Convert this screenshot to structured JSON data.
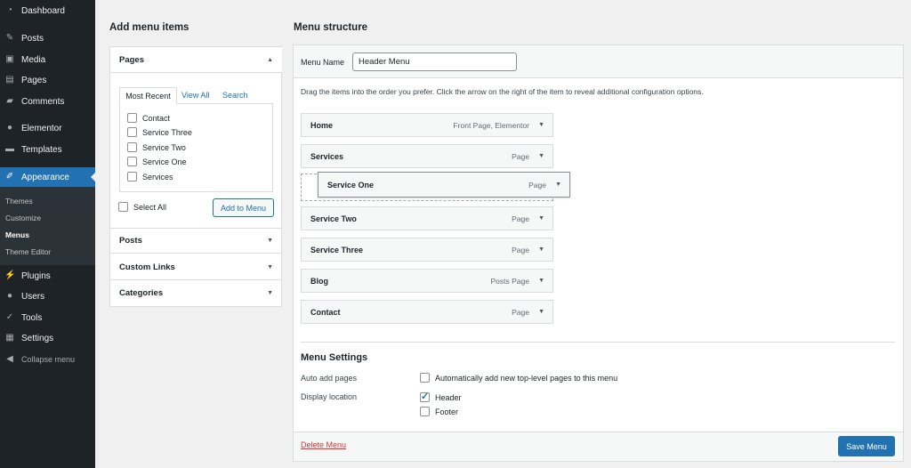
{
  "sidebar": {
    "items": [
      {
        "label": "Dashboard",
        "icon": "dashboard-icon"
      },
      {
        "label": "Posts",
        "icon": "pin-icon"
      },
      {
        "label": "Media",
        "icon": "media-icon"
      },
      {
        "label": "Pages",
        "icon": "pages-icon"
      },
      {
        "label": "Comments",
        "icon": "comment-icon"
      },
      {
        "label": "Elementor",
        "icon": "elementor-icon"
      },
      {
        "label": "Templates",
        "icon": "folder-icon"
      },
      {
        "label": "Appearance",
        "icon": "brush-icon"
      },
      {
        "label": "Plugins",
        "icon": "plugin-icon"
      },
      {
        "label": "Users",
        "icon": "user-icon"
      },
      {
        "label": "Tools",
        "icon": "wrench-icon"
      },
      {
        "label": "Settings",
        "icon": "settings-icon"
      },
      {
        "label": "Collapse menu",
        "icon": "collapse-icon"
      }
    ],
    "submenu": [
      "Themes",
      "Customize",
      "Menus",
      "Theme Editor"
    ]
  },
  "add_items": {
    "title": "Add menu items",
    "pages": {
      "title": "Pages",
      "tabs": [
        "Most Recent",
        "View All",
        "Search"
      ],
      "list": [
        "Contact",
        "Service Three",
        "Service Two",
        "Service One",
        "Services"
      ],
      "select_all": "Select All",
      "add_button": "Add to Menu"
    },
    "sections": [
      "Posts",
      "Custom Links",
      "Categories"
    ]
  },
  "structure": {
    "title": "Menu structure",
    "menu_name_label": "Menu Name",
    "menu_name_value": "Header Menu",
    "instructions": "Drag the items into the order you prefer. Click the arrow on the right of the item to reveal additional configuration options.",
    "items": [
      {
        "label": "Home",
        "type": "Front Page, Elementor"
      },
      {
        "label": "Services",
        "type": "Page"
      },
      {
        "label": "Service One",
        "type": "Page"
      },
      {
        "label": "Service Two",
        "type": "Page"
      },
      {
        "label": "Service Three",
        "type": "Page"
      },
      {
        "label": "Blog",
        "type": "Posts Page"
      },
      {
        "label": "Contact",
        "type": "Page"
      }
    ],
    "settings": {
      "title": "Menu Settings",
      "auto_add_label": "Auto add pages",
      "auto_add_option": "Automatically add new top-level pages to this menu",
      "auto_add_checked": false,
      "location_label": "Display location",
      "locations": [
        {
          "label": "Header",
          "checked": true
        },
        {
          "label": "Footer",
          "checked": false
        }
      ]
    },
    "delete_label": "Delete Menu",
    "save_label": "Save Menu"
  },
  "colors": {
    "sidebar": "#1d2327",
    "accent": "#2271b1",
    "delete": "#d63638"
  }
}
